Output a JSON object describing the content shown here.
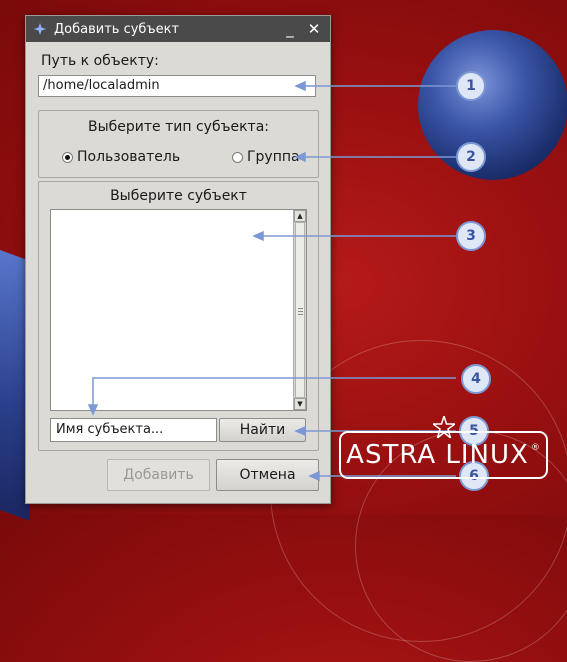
{
  "window": {
    "title": "Добавить субъект",
    "minimize_label": "_",
    "close_label": "✕"
  },
  "path": {
    "label": "Путь к объекту:",
    "value": "/home/localadmin"
  },
  "subject_type": {
    "heading": "Выберите тип субъекта:",
    "options": [
      {
        "label": "Пользователь",
        "checked": true
      },
      {
        "label": "Группа",
        "checked": false
      }
    ]
  },
  "subject_select": {
    "heading": "Выберите субъект",
    "items": [],
    "name_placeholder": "Имя субъекта...",
    "find_label": "Найти"
  },
  "footer": {
    "add_label": "Добавить",
    "cancel_label": "Отмена"
  },
  "callouts": [
    "1",
    "2",
    "3",
    "4",
    "5",
    "6"
  ],
  "logo": {
    "text": "ASTRA LINUX",
    "reg_mark": "®"
  },
  "icons": {
    "window_icon": "astra-star-icon",
    "scroll_up": "arrow-up-icon",
    "scroll_down": "arrow-down-icon"
  },
  "colors": {
    "background": "#9a1010",
    "titlebar": "#4a4a4a",
    "dialog": "#dcdad5",
    "callout_border": "#7c98d4",
    "callout_fill": "#dfe7f7"
  }
}
